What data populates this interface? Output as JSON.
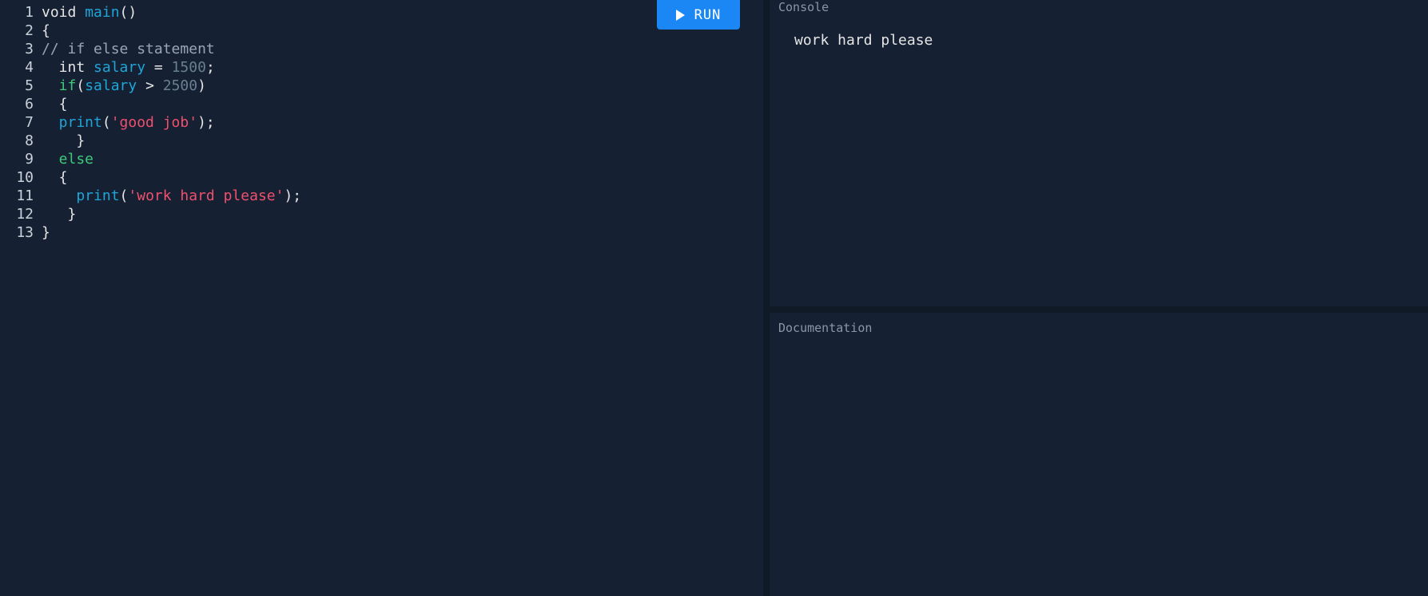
{
  "editor": {
    "lines": [
      {
        "num": "1",
        "tokens": [
          [
            "plain",
            "void "
          ],
          [
            "fn",
            "main"
          ],
          [
            "plain",
            "()"
          ]
        ]
      },
      {
        "num": "2",
        "tokens": [
          [
            "plain",
            "{"
          ]
        ]
      },
      {
        "num": "3",
        "tokens": [
          [
            "cmt",
            "// if else statement"
          ]
        ]
      },
      {
        "num": "4",
        "tokens": [
          [
            "plain",
            "  int "
          ],
          [
            "var",
            "salary"
          ],
          [
            "plain",
            " = "
          ],
          [
            "num",
            "1500"
          ],
          [
            "plain",
            ";"
          ]
        ]
      },
      {
        "num": "5",
        "tokens": [
          [
            "kw",
            "  if"
          ],
          [
            "plain",
            "("
          ],
          [
            "var",
            "salary"
          ],
          [
            "plain",
            " > "
          ],
          [
            "num",
            "2500"
          ],
          [
            "plain",
            ")"
          ]
        ]
      },
      {
        "num": "6",
        "tokens": [
          [
            "plain",
            "  {"
          ]
        ]
      },
      {
        "num": "7",
        "tokens": [
          [
            "fn",
            "  print"
          ],
          [
            "plain",
            "("
          ],
          [
            "str",
            "'good job'"
          ],
          [
            "plain",
            ");"
          ]
        ]
      },
      {
        "num": "8",
        "tokens": [
          [
            "plain",
            "    }"
          ]
        ]
      },
      {
        "num": "9",
        "tokens": [
          [
            "kw",
            "  else"
          ]
        ]
      },
      {
        "num": "10",
        "tokens": [
          [
            "plain",
            "  {"
          ]
        ]
      },
      {
        "num": "11",
        "tokens": [
          [
            "fn",
            "    print"
          ],
          [
            "plain",
            "("
          ],
          [
            "str",
            "'work hard please'"
          ],
          [
            "plain",
            ");"
          ]
        ]
      },
      {
        "num": "12",
        "tokens": [
          [
            "plain",
            "   }"
          ]
        ]
      },
      {
        "num": "13",
        "tokens": [
          [
            "plain",
            "}"
          ]
        ]
      }
    ]
  },
  "toolbar": {
    "run_label": "RUN",
    "run_icon": "play-icon",
    "run_color": "#1b87f5"
  },
  "console": {
    "title": "Console",
    "output": "work hard please"
  },
  "documentation": {
    "title": "Documentation"
  },
  "colors": {
    "background": "#141f2f",
    "function": "#1fa5d8",
    "keyword": "#3fc87a",
    "string": "#f0506e",
    "number": "#6b7f93",
    "comment": "#9aa6b8"
  }
}
